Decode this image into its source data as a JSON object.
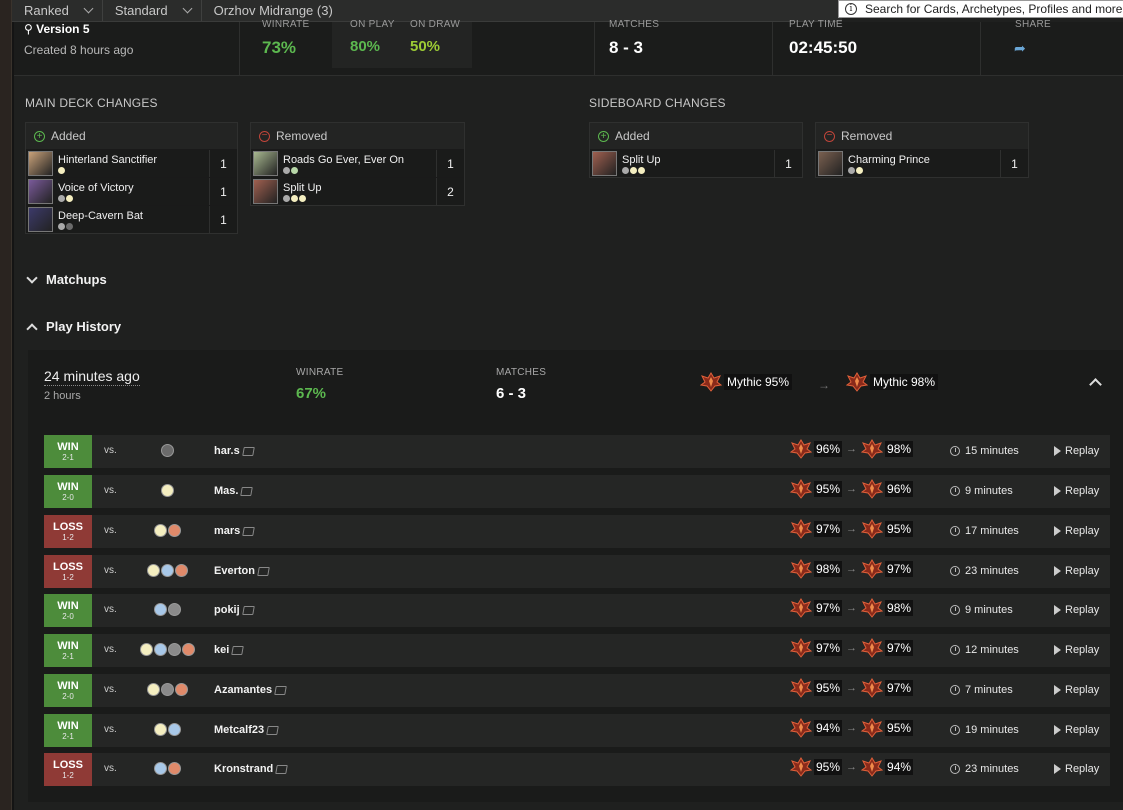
{
  "filters": [
    "Ranked",
    "Standard",
    "Orzhov Midrange (3)"
  ],
  "search": {
    "placeholder": "Search for Cards, Archetypes, Profiles and more"
  },
  "summary": {
    "version": "Version 5",
    "created": "Created 8 hours ago",
    "winrate_label": "WINRATE",
    "winrate": "73%",
    "on_play_label": "ON PLAY",
    "on_play": "80%",
    "on_draw_label": "ON DRAW",
    "on_draw": "50%",
    "matches_label": "MATCHES",
    "matches": "8 - 3",
    "playtime_label": "PLAY TIME",
    "playtime": "02:45:50",
    "share_label": "SHARE"
  },
  "changes": {
    "main_title": "MAIN DECK CHANGES",
    "side_title": "SIDEBOARD CHANGES",
    "added_label": "Added",
    "removed_label": "Removed",
    "main_added": [
      {
        "name": "Hinterland Sanctifier",
        "count": "1",
        "pips": [
          "#f4eec0"
        ],
        "art": "#c9a27a"
      },
      {
        "name": "Voice of Victory",
        "count": "1",
        "pips": [
          "#aaaaaa",
          "#f4eec0"
        ],
        "art": "#7a5a9a"
      },
      {
        "name": "Deep-Cavern Bat",
        "count": "1",
        "pips": [
          "#aaaaaa",
          "#6b6b6b"
        ],
        "art": "#3c3a6a"
      }
    ],
    "main_removed": [
      {
        "name": "Roads Go Ever, Ever On",
        "count": "1",
        "pips": [
          "#aaaaaa",
          "#b8d8a8"
        ],
        "art": "#a8b890"
      },
      {
        "name": "Split Up",
        "count": "2",
        "pips": [
          "#aaaaaa",
          "#f4eec0",
          "#f4eec0"
        ],
        "art": "#a06050"
      }
    ],
    "side_added": [
      {
        "name": "Split Up",
        "count": "1",
        "pips": [
          "#aaaaaa",
          "#f4eec0",
          "#f4eec0"
        ],
        "art": "#a06050"
      }
    ],
    "side_removed": [
      {
        "name": "Charming Prince",
        "count": "1",
        "pips": [
          "#aaaaaa",
          "#f4eec0"
        ],
        "art": "#7a6050"
      }
    ]
  },
  "sections": {
    "matchups": "Matchups",
    "play_history": "Play History"
  },
  "session": {
    "when": "24 minutes ago",
    "duration": "2 hours",
    "winrate_label": "WINRATE",
    "winrate": "67%",
    "matches_label": "MATCHES",
    "matches": "6 - 3",
    "rank_from": "Mythic 95%",
    "rank_to": "Mythic 98%"
  },
  "replay_label": "Replay",
  "vs_label": "vs.",
  "matches": [
    {
      "result": "WIN",
      "score": "2-1",
      "colors": [
        "#6b6b6b"
      ],
      "opponent": "har.s",
      "from": "96%",
      "to": "98%",
      "duration": "15 minutes"
    },
    {
      "result": "WIN",
      "score": "2-0",
      "colors": [
        "#f4eec0"
      ],
      "opponent": "Mas.",
      "from": "95%",
      "to": "96%",
      "duration": "9 minutes"
    },
    {
      "result": "LOSS",
      "score": "1-2",
      "colors": [
        "#f4eec0",
        "#e08a6a"
      ],
      "opponent": "mars",
      "from": "97%",
      "to": "95%",
      "duration": "17 minutes"
    },
    {
      "result": "LOSS",
      "score": "1-2",
      "colors": [
        "#f4eec0",
        "#a8c8e8",
        "#e08a6a"
      ],
      "opponent": "Everton",
      "from": "98%",
      "to": "97%",
      "duration": "23 minutes"
    },
    {
      "result": "WIN",
      "score": "2-0",
      "colors": [
        "#a8c8e8",
        "#8a8a8a"
      ],
      "opponent": "pokij",
      "from": "97%",
      "to": "98%",
      "duration": "9 minutes"
    },
    {
      "result": "WIN",
      "score": "2-1",
      "colors": [
        "#f4eec0",
        "#a8c8e8",
        "#8a8a8a",
        "#e08a6a"
      ],
      "opponent": "kei",
      "from": "97%",
      "to": "97%",
      "duration": "12 minutes"
    },
    {
      "result": "WIN",
      "score": "2-0",
      "colors": [
        "#f4eec0",
        "#8a8a8a",
        "#e08a6a"
      ],
      "opponent": "Azamantes",
      "from": "95%",
      "to": "97%",
      "duration": "7 minutes"
    },
    {
      "result": "WIN",
      "score": "2-1",
      "colors": [
        "#f4eec0",
        "#a8c8e8"
      ],
      "opponent": "Metcalf23",
      "from": "94%",
      "to": "95%",
      "duration": "19 minutes"
    },
    {
      "result": "LOSS",
      "score": "1-2",
      "colors": [
        "#a8c8e8",
        "#e08a6a"
      ],
      "opponent": "Kronstrand",
      "from": "95%",
      "to": "94%",
      "duration": "23 minutes"
    }
  ]
}
